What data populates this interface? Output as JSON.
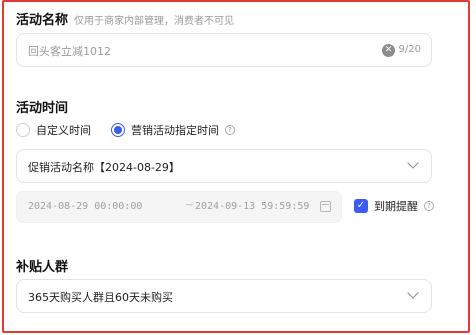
{
  "activity_name": {
    "title": "活动名称",
    "hint": "仅用于商家内部管理，消费者不可见",
    "value": "回头客立减1012",
    "count": "9/20"
  },
  "activity_time": {
    "title": "活动时间",
    "options": [
      {
        "label": "自定义时间",
        "selected": false
      },
      {
        "label": "营销活动指定时间",
        "selected": true
      }
    ],
    "select_value": "促销活动名称【2024-08-29】",
    "start": "2024-08-29 00:00:00",
    "separator": "~",
    "end": "2024-09-13 59:59:59",
    "reminder_label": "到期提醒",
    "reminder_checked": true
  },
  "subsidy_crowd": {
    "title": "补贴人群",
    "select_value": "365天购买人群且60天未购买"
  },
  "colors": {
    "accent": "#3a5cf2",
    "highlight_border": "#e53935"
  },
  "icons": {
    "clear": "clear-icon",
    "help": "help-icon",
    "chevron": "chevron-down-icon",
    "calendar": "calendar-icon",
    "check": "checkmark-icon"
  }
}
